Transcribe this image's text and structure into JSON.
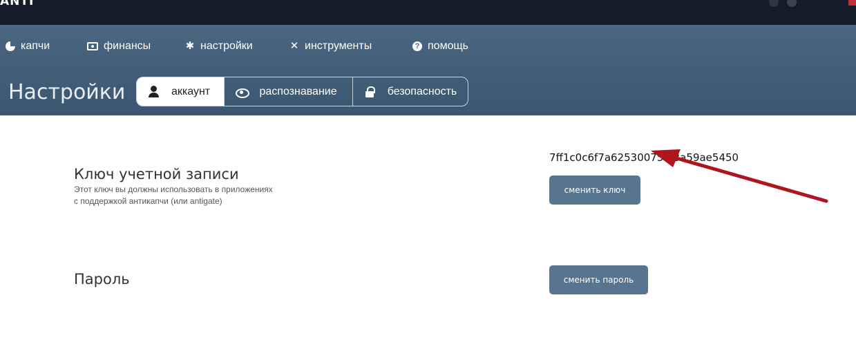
{
  "topbar": {
    "logo_text": "ANTI",
    "icons": [
      "shield-icon",
      "info-icon"
    ],
    "flag": "flag-icon"
  },
  "nav": {
    "items": [
      {
        "label": "капчи",
        "icon": "pie-chart-icon"
      },
      {
        "label": "финансы",
        "icon": "money-icon"
      },
      {
        "label": "настройки",
        "icon": "gear-icon"
      },
      {
        "label": "инструменты",
        "icon": "tools-icon"
      },
      {
        "label": "помощь",
        "icon": "help-icon"
      }
    ]
  },
  "page": {
    "title": "Настройки"
  },
  "tabs": [
    {
      "label": "аккаунт",
      "icon": "user-icon",
      "active": true
    },
    {
      "label": "распознавание",
      "icon": "eye-icon",
      "active": false
    },
    {
      "label": "безопасность",
      "icon": "lock-icon",
      "active": false
    }
  ],
  "account_key": {
    "title": "Ключ учетной записи",
    "description_line1": "Этот ключ вы должны использовать в приложениях",
    "description_line2": "с поддержкой антикапчи (или antigate)",
    "value": "7ff1c0c6f7a62530075...3a59ae5450",
    "button_label": "сменить ключ"
  },
  "password": {
    "title": "Пароль",
    "button_label": "сменить пароль"
  },
  "colors": {
    "header": "#4b6680",
    "topbar": "#141c29",
    "button": "#587590",
    "arrow": "#b0141c"
  }
}
